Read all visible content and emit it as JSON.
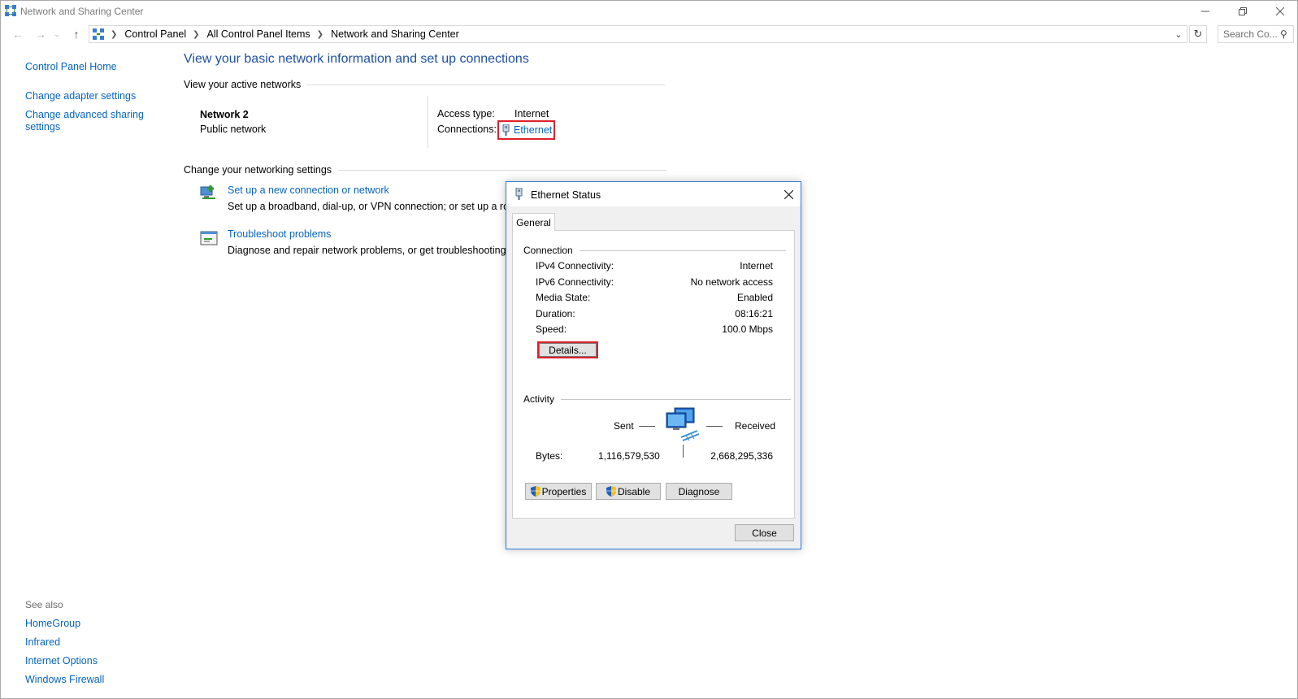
{
  "window": {
    "title": "Network and Sharing Center"
  },
  "address": {
    "crumbs": [
      "Control Panel",
      "All Control Panel Items",
      "Network and Sharing Center"
    ],
    "search_placeholder": "Search Co..."
  },
  "sidebar": {
    "home": "Control Panel Home",
    "adapter": "Change adapter settings",
    "advanced_line1": "Change advanced sharing",
    "advanced_line2": "settings",
    "see_also": "See also",
    "see_also_items": [
      "HomeGroup",
      "Infrared",
      "Internet Options",
      "Windows Firewall"
    ]
  },
  "main": {
    "title": "View your basic network information and set up connections",
    "active_networks_head": "View your active networks",
    "network_name": "Network  2",
    "network_type": "Public network",
    "access_type_label": "Access type:",
    "access_type_value": "Internet",
    "connections_label": "Connections:",
    "connection_name": "Ethernet",
    "change_settings_head": "Change your networking settings",
    "setup_link": "Set up a new connection or network",
    "setup_desc": "Set up a broadband, dial-up, or VPN connection; or set up a route",
    "troubleshoot_link": "Troubleshoot problems",
    "troubleshoot_desc": "Diagnose and repair network problems, or get troubleshooting in"
  },
  "dialog": {
    "title": "Ethernet Status",
    "tab": "General",
    "connection_head": "Connection",
    "rows": [
      {
        "label": "IPv4 Connectivity:",
        "value": "Internet"
      },
      {
        "label": "IPv6 Connectivity:",
        "value": "No network access"
      },
      {
        "label": "Media State:",
        "value": "Enabled"
      },
      {
        "label": "Duration:",
        "value": "08:16:21"
      },
      {
        "label": "Speed:",
        "value": "100.0 Mbps"
      }
    ],
    "details_button": "Details...",
    "activity_head": "Activity",
    "sent_label": "Sent",
    "received_label": "Received",
    "bytes_label": "Bytes:",
    "bytes_sent": "1,116,579,530",
    "bytes_received": "2,668,295,336",
    "properties_button": "Properties",
    "disable_button": "Disable",
    "diagnose_button": "Diagnose",
    "close_button": "Close"
  }
}
